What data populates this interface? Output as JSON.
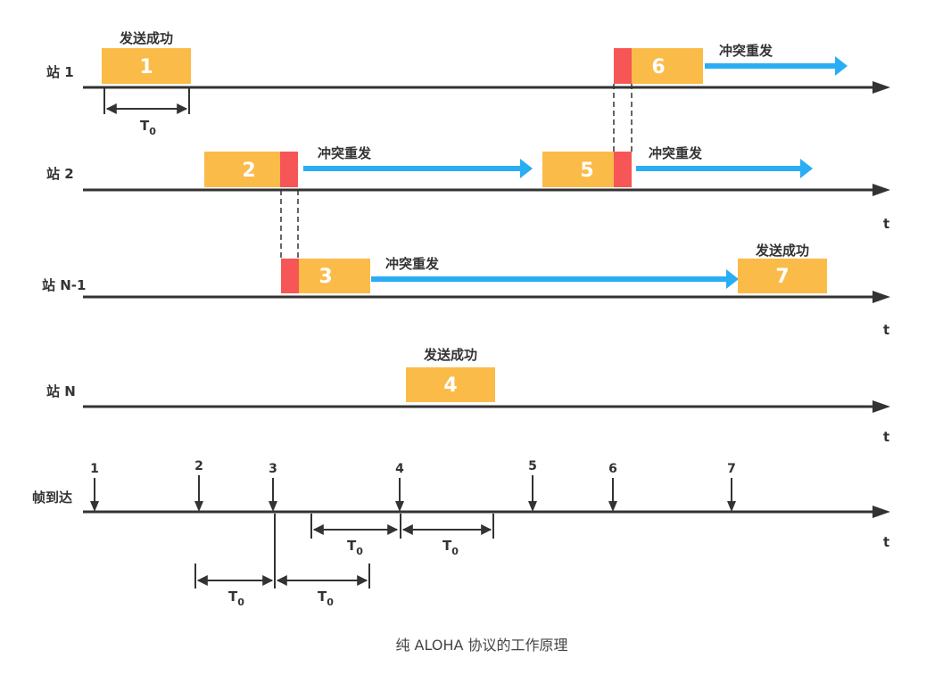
{
  "caption": "纯 ALOHA 协议的工作原理",
  "colors": {
    "frame": "#fbbb49",
    "collision": "#f65656",
    "retransmit": "#29adf5",
    "axis": "#333333"
  },
  "time_label": "t",
  "period_label": {
    "main": "T",
    "sub": "0"
  },
  "stations": [
    {
      "label": "站 1"
    },
    {
      "label": "站 2"
    },
    {
      "label": "站 N-1"
    },
    {
      "label": "站 N"
    }
  ],
  "arrivals_label": "帧到达",
  "arrivals": [
    "1",
    "2",
    "3",
    "4",
    "5",
    "6",
    "7"
  ],
  "frames": [
    {
      "number": "1",
      "note": "发送成功"
    },
    {
      "number": "6",
      "note": "冲突重发"
    },
    {
      "number": "2",
      "note": "冲突重发"
    },
    {
      "number": "5",
      "note": "冲突重发"
    },
    {
      "number": "3",
      "note": "冲突重发"
    },
    {
      "number": "7",
      "note": "发送成功"
    },
    {
      "number": "4",
      "note": "发送成功"
    }
  ]
}
